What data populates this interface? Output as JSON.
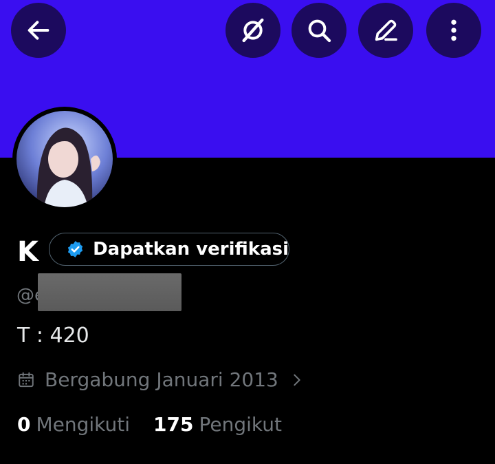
{
  "colors": {
    "banner": "#3a0ef0",
    "button_bg": "#1c0a5e",
    "verified": "#1d9bf0",
    "muted": "#71767b"
  },
  "header": {
    "buttons": [
      {
        "icon": "arrow-left-icon"
      },
      {
        "icon": "grok-icon"
      },
      {
        "icon": "search-icon"
      },
      {
        "icon": "edit-icon"
      },
      {
        "icon": "more-vertical-icon"
      }
    ]
  },
  "profile": {
    "name": "K",
    "verify_label": "Dapatkan verifikasi",
    "handle": "@e",
    "bio": "T : 420",
    "joined": "Bergabung Januari 2013",
    "following_count": "0",
    "following_label": "Mengikuti",
    "followers_count": "175",
    "followers_label": "Pengikut"
  }
}
